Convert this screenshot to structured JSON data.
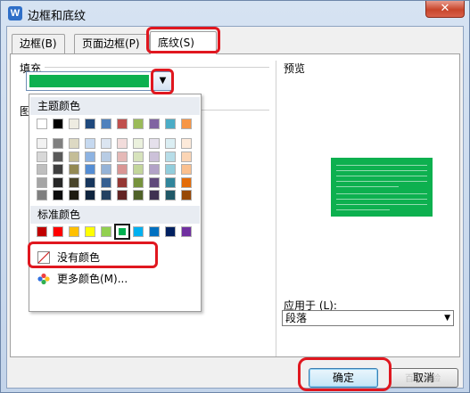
{
  "window": {
    "title": "边框和底纹",
    "close_glyph": "✕",
    "app_icon_letter": "W"
  },
  "tabs": [
    {
      "label": "边框(B)"
    },
    {
      "label": "页面边框(P)"
    },
    {
      "label": "底纹(S)"
    }
  ],
  "fill": {
    "label": "填充",
    "selected_color": "#0db04f",
    "arrow_glyph": "▼"
  },
  "pattern": {
    "label_fragment": "图"
  },
  "preview": {
    "label": "预览",
    "fill_color": "#0db04f"
  },
  "color_menu": {
    "theme_header": "主题颜色",
    "standard_header": "标准颜色",
    "theme_top_row": [
      "#ffffff",
      "#000000",
      "#eeece1",
      "#1f497d",
      "#4f81bd",
      "#c0504d",
      "#9bbb59",
      "#8064a2",
      "#4bacc6",
      "#f79646"
    ],
    "theme_shades": [
      [
        "#f2f2f2",
        "#7f7f7f",
        "#ddd9c3",
        "#c6d9f0",
        "#dbe5f1",
        "#f2dcdb",
        "#ebf1dd",
        "#e5e0ec",
        "#dbeef3",
        "#fdeada"
      ],
      [
        "#d8d8d8",
        "#595959",
        "#c4bd97",
        "#8db3e2",
        "#b8cce4",
        "#e5b9b7",
        "#d7e3bc",
        "#ccc1d9",
        "#b7dde8",
        "#fbd5b5"
      ],
      [
        "#bfbfbf",
        "#3f3f3f",
        "#938953",
        "#548dd4",
        "#95b3d7",
        "#d99694",
        "#c3d69b",
        "#b2a2c7",
        "#92cddc",
        "#fac08f"
      ],
      [
        "#a5a5a5",
        "#262626",
        "#494429",
        "#17365d",
        "#366092",
        "#953734",
        "#76923c",
        "#5f497a",
        "#31859b",
        "#e36c09"
      ],
      [
        "#7f7f7f",
        "#0c0c0c",
        "#1d1b10",
        "#0f243e",
        "#244061",
        "#632423",
        "#4f6128",
        "#3f3151",
        "#205867",
        "#974806"
      ]
    ],
    "standard_colors": [
      "#c00000",
      "#ff0000",
      "#ffc000",
      "#ffff00",
      "#92d050",
      "#00b050",
      "#00b0f0",
      "#0070c0",
      "#002060",
      "#7030a0"
    ],
    "selected_standard_index": 5,
    "no_color_label": "没有颜色",
    "more_colors_label": "更多颜色(M)..."
  },
  "apply_to": {
    "label": "应用于 (L):",
    "value": "段落",
    "arrow_glyph": "▼"
  },
  "buttons": {
    "ok": "确定",
    "cancel": "取消"
  },
  "annotation_color": "#e0171f",
  "watermark": "百度经验"
}
